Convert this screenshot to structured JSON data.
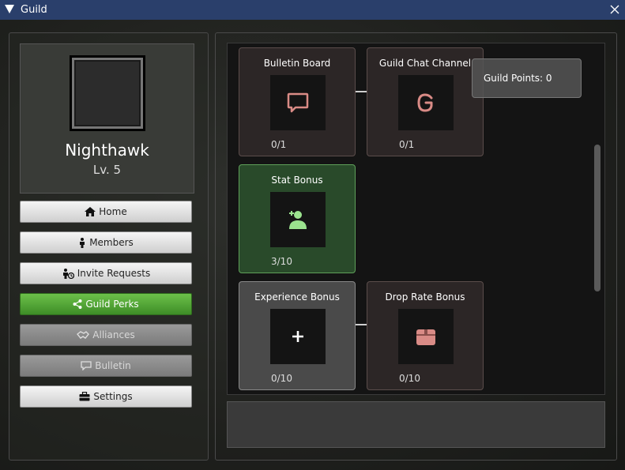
{
  "window": {
    "title": "Guild"
  },
  "profile": {
    "name": "Nighthawk",
    "level": "Lv. 5"
  },
  "nav": [
    {
      "id": "home",
      "label": "Home",
      "icon": "home-icon",
      "state": "normal"
    },
    {
      "id": "members",
      "label": "Members",
      "icon": "person-icon",
      "state": "normal"
    },
    {
      "id": "invite-requests",
      "label": "Invite Requests",
      "icon": "invite-icon",
      "state": "normal"
    },
    {
      "id": "guild-perks",
      "label": "Guild Perks",
      "icon": "share-icon",
      "state": "active"
    },
    {
      "id": "alliances",
      "label": "Alliances",
      "icon": "handshake-icon",
      "state": "disabled"
    },
    {
      "id": "bulletin",
      "label": "Bulletin",
      "icon": "chat-icon",
      "state": "disabled"
    },
    {
      "id": "settings",
      "label": "Settings",
      "icon": "toolbox-icon",
      "state": "normal"
    }
  ],
  "perks": [
    {
      "title": "Bulletin Board",
      "count": "0/1",
      "icon": "chat-bubble-icon",
      "state": "locked"
    },
    {
      "title": "Guild Chat Channel",
      "count": "0/1",
      "icon": "letter-g-icon",
      "state": "locked"
    },
    {
      "title": "Stat Bonus",
      "count": "3/10",
      "icon": "person-bonus-icon",
      "state": "owned"
    },
    {
      "title": "Experience Bonus",
      "count": "0/10",
      "icon": "plus-icon",
      "state": "available"
    },
    {
      "title": "Drop Rate Bonus",
      "count": "0/10",
      "icon": "box-icon",
      "state": "locked"
    }
  ],
  "guild_points": {
    "label": "Guild Points: 0"
  },
  "colors": {
    "titlebar": "#2a3f6b",
    "active_nav": "#4fa534",
    "locked_icon": "#d98b86",
    "owned_icon": "#9be38e"
  }
}
